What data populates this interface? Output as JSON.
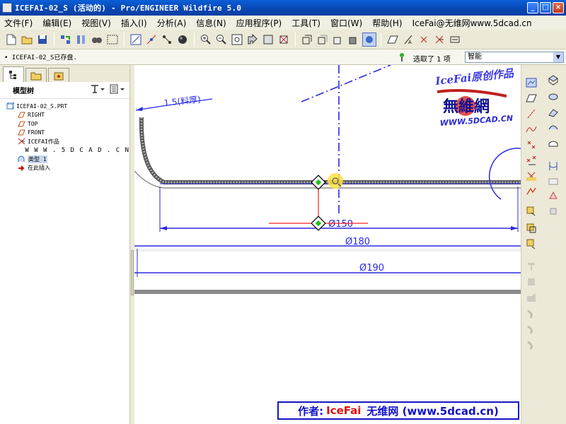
{
  "window": {
    "title": "ICEFAI-02_S (活动的) - Pro/ENGINEER Wildfire 5.0"
  },
  "menubar": {
    "items": [
      "文件(F)",
      "编辑(E)",
      "视图(V)",
      "插入(I)",
      "分析(A)",
      "信息(N)",
      "应用程序(P)",
      "工具(T)",
      "窗口(W)",
      "帮助(H)",
      "IceFai@无维网www.5dcad.cn"
    ]
  },
  "message_bar": {
    "message": "• ICEFAI-02_S已存盘.",
    "selection_status": "选取了 1 项",
    "filter_value": "智能"
  },
  "left_panel": {
    "header": "模型树",
    "tree": [
      {
        "label": "ICEFAI-02_S.PRT",
        "icon": "part-icon"
      },
      {
        "label": "RIGHT",
        "icon": "datum-plane-icon"
      },
      {
        "label": "TOP",
        "icon": "datum-plane-icon"
      },
      {
        "label": "FRONT",
        "icon": "datum-plane-icon"
      },
      {
        "label": "ICEFAI作品",
        "icon": "csys-icon"
      },
      {
        "label": "W W W . 5 D C A D . C N",
        "icon": "text-icon"
      },
      {
        "label": "类型 1",
        "icon": "feature-icon"
      },
      {
        "label": "在此插入",
        "icon": "insert-arrow-icon"
      }
    ]
  },
  "drawing": {
    "annotations": {
      "thickness": "1.5(料厚)",
      "dia_150": "Ø150",
      "dia_180": "Ø180",
      "dia_190": "Ø190"
    },
    "colors": {
      "sketch": "#2a2ae0",
      "selection": "#ff2020",
      "handle": "#20c020"
    }
  },
  "watermark": {
    "line1": "IceFai原创作品",
    "line2": "無維網",
    "line3": "WWW.5DCAD.CN"
  },
  "banner": {
    "prefix": "作者:",
    "author": "IceFai",
    "suffix": "无维网 (www.5dcad.cn)"
  }
}
